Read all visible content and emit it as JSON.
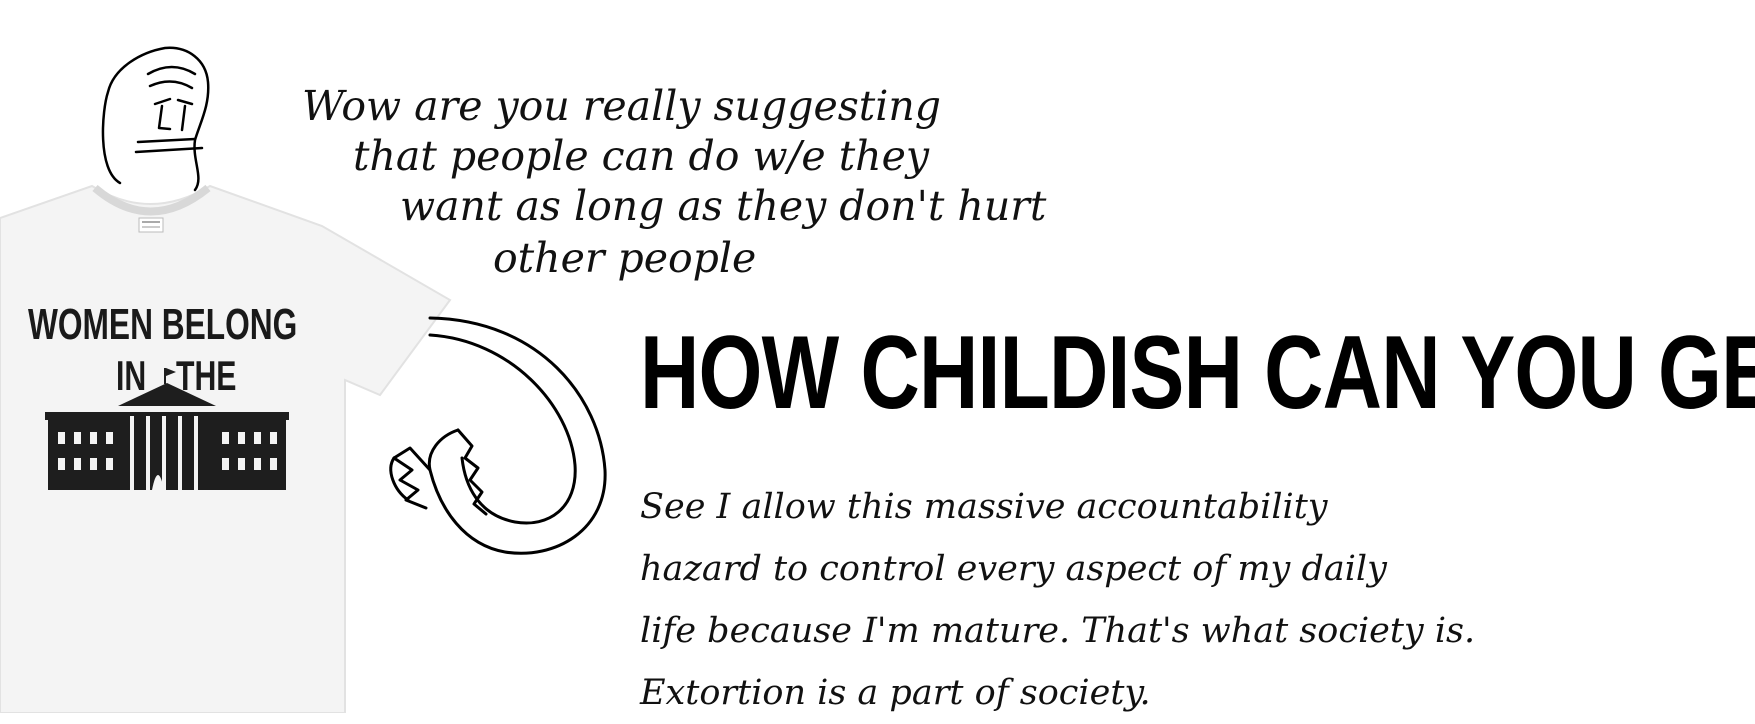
{
  "top_speech": [
    "Wow are you really suggesting",
    "that people can do w/e they",
    "want as long as they don't hurt",
    "other people"
  ],
  "headline": "HOW CHILDISH CAN YOU GET",
  "reply_lines": [
    "See I allow this massive accountability",
    "hazard to control every aspect of my daily",
    "life because I'm mature. That's what society is.",
    "Extortion is a part of society."
  ],
  "shirt": {
    "line1": "WOMEN BELONG",
    "line2_left": "IN",
    "line2_right": "THE"
  },
  "colors": {
    "ink": "#000000",
    "background": "#ffffff",
    "shirt": "#f4f4f4"
  }
}
